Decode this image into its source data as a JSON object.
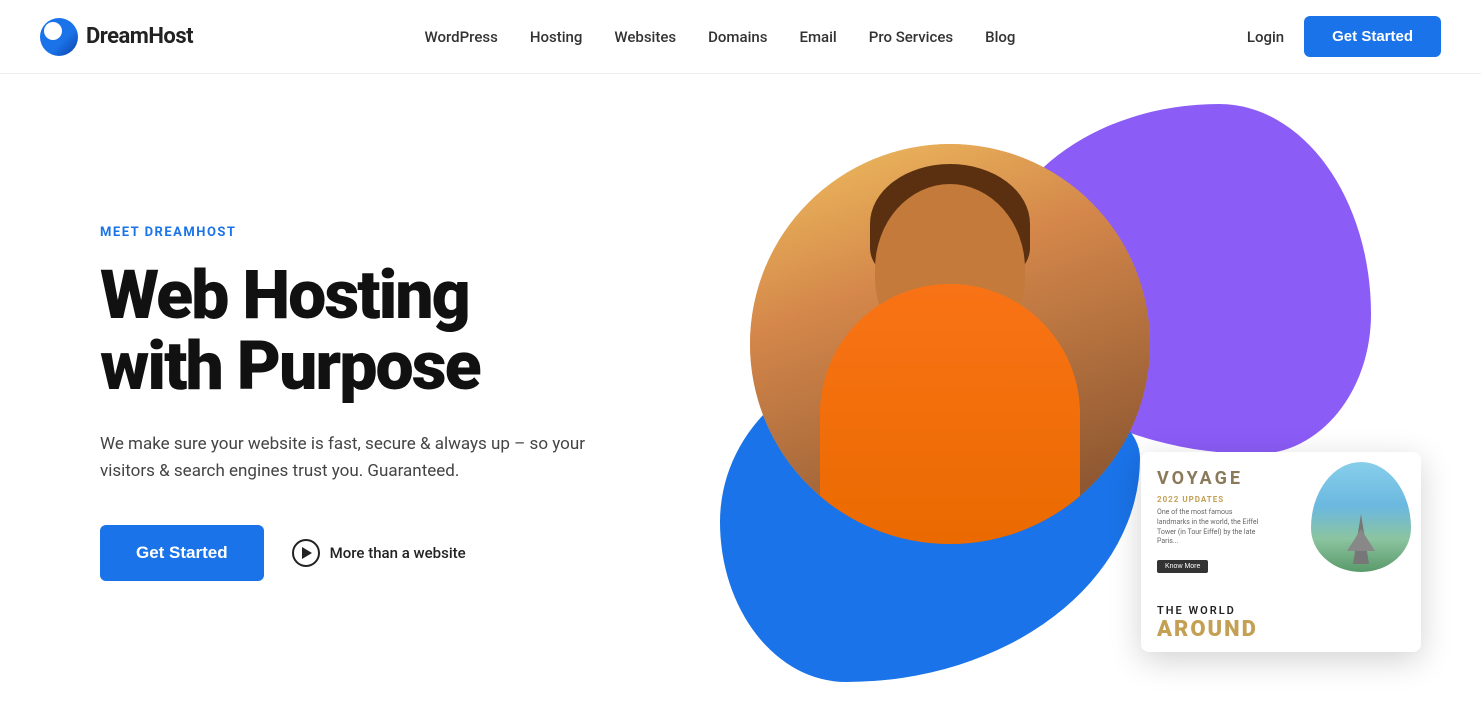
{
  "brand": {
    "name": "DreamHost"
  },
  "nav": {
    "links": [
      {
        "label": "WordPress",
        "id": "wordpress"
      },
      {
        "label": "Hosting",
        "id": "hosting"
      },
      {
        "label": "Websites",
        "id": "websites"
      },
      {
        "label": "Domains",
        "id": "domains"
      },
      {
        "label": "Email",
        "id": "email"
      },
      {
        "label": "Pro Services",
        "id": "pro-services"
      },
      {
        "label": "Blog",
        "id": "blog"
      }
    ],
    "login_label": "Login",
    "cta_label": "Get Started"
  },
  "hero": {
    "eyebrow": "MEET DREAMHOST",
    "title_line1": "Web Hosting",
    "title_line2": "with Purpose",
    "subtitle": "We make sure your website is fast, secure & always up – so your visitors & search engines trust you. Guaranteed.",
    "cta_label": "Get Started",
    "secondary_label": "More than a website"
  },
  "voyage_card": {
    "title": "VOYAGE",
    "update_label": "2022 UPDATES",
    "update_text": "One of the most famous landmarks in the world, the Eiffel Tower (in Tour Eiffel) by the late Paris...",
    "btn_label": "Know More",
    "the": "THE WORLD",
    "around": "AROUND"
  }
}
